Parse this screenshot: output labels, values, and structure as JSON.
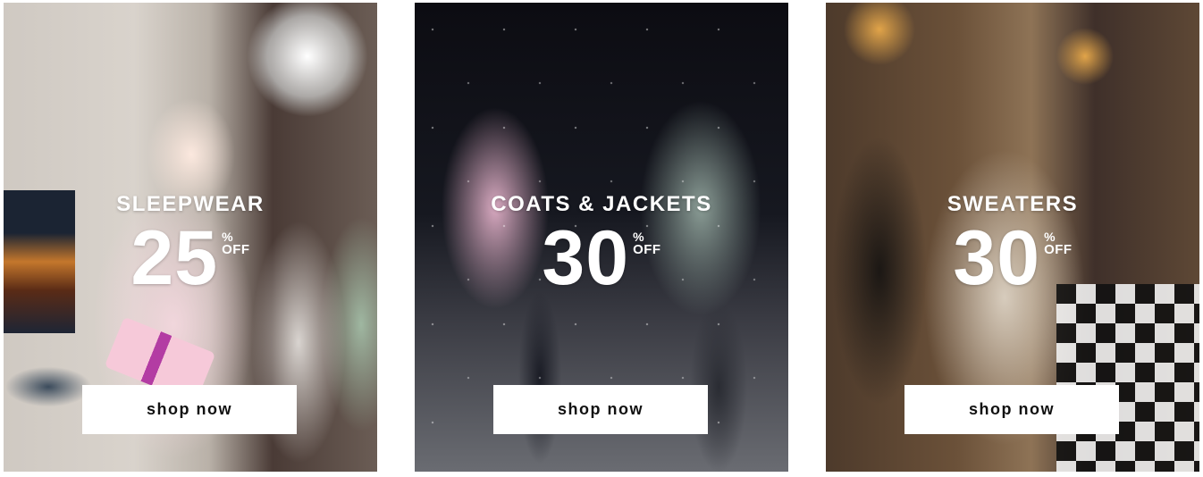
{
  "promos": [
    {
      "category": "SLEEPWEAR",
      "discount": "25",
      "percent_sign": "%",
      "off": "OFF",
      "cta": "shop now"
    },
    {
      "category": "COATS & JACKETS",
      "discount": "30",
      "percent_sign": "%",
      "off": "OFF",
      "cta": "shop now"
    },
    {
      "category": "SWEATERS",
      "discount": "30",
      "percent_sign": "%",
      "off": "OFF",
      "cta": "shop now"
    }
  ]
}
